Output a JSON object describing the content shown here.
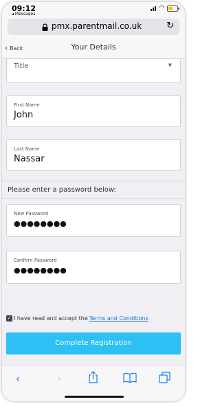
{
  "status_bar": {
    "time": "09:12",
    "back_app": "◂ Messages"
  },
  "browser": {
    "url": "pmx.parentmail.co.uk"
  },
  "nav": {
    "back_label": "Back",
    "title": "Your Details"
  },
  "form": {
    "title_placeholder": "Title",
    "first_name_label": "First Name",
    "first_name_value": "John",
    "last_name_label": "Last Name",
    "last_name_value": "Nassar",
    "password_prompt": "Please enter a password below:",
    "new_password_label": "New Password",
    "new_password_value": "●●●●●●●●",
    "confirm_password_label": "Confirm Password",
    "confirm_password_value": "●●●●●●●●",
    "terms_text": "I have read and accept the",
    "terms_link": "Terms and Conditions",
    "terms_checked": true,
    "submit_label": "Complete Registration"
  },
  "icons": [
    "lock-icon",
    "reload-icon",
    "back-chevron-icon",
    "dropdown-chevron-icon",
    "checkbox-icon",
    "share-icon",
    "bookmarks-icon",
    "tabs-icon",
    "forward-icon"
  ],
  "colors": {
    "accent": "#2cc0f5",
    "link": "#1a73d9",
    "toolbar_icon": "#1a7cf0"
  }
}
